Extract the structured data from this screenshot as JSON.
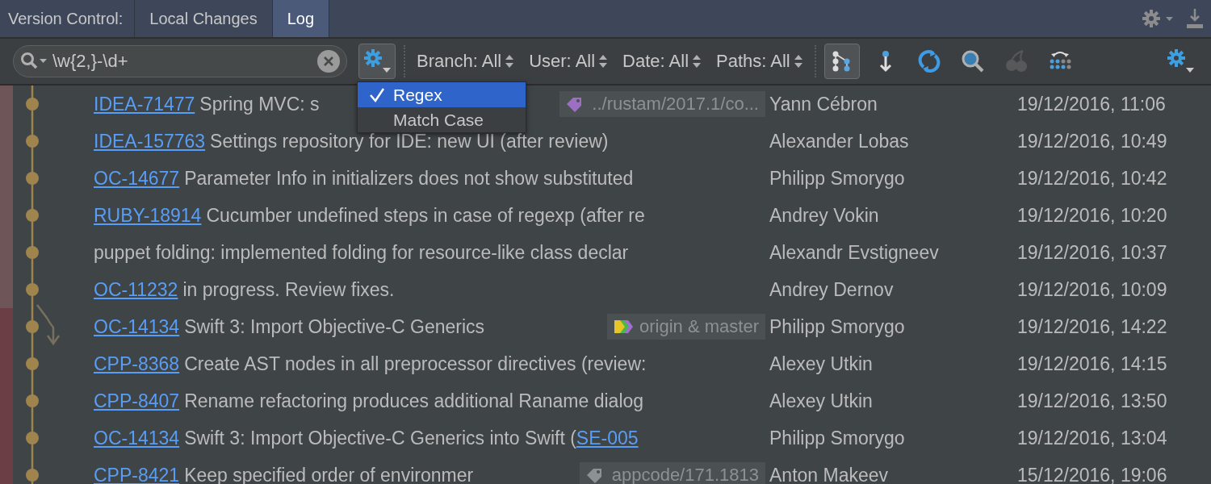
{
  "header": {
    "title": "Version Control:",
    "tabs": [
      {
        "label": "Local Changes",
        "selected": false
      },
      {
        "label": "Log",
        "selected": true
      }
    ]
  },
  "toolbar": {
    "search": {
      "value": "\\w{2,}-\\d+"
    },
    "filters": [
      {
        "label": "Branch: All"
      },
      {
        "label": "User: All"
      },
      {
        "label": "Date: All"
      },
      {
        "label": "Paths: All"
      }
    ],
    "tools": [
      {
        "kind": "graph",
        "selected": true,
        "disabled": false
      },
      {
        "kind": "fetch",
        "selected": false,
        "disabled": false
      },
      {
        "kind": "refresh",
        "selected": false,
        "disabled": false
      },
      {
        "kind": "search",
        "selected": false,
        "disabled": false
      },
      {
        "kind": "cherry",
        "selected": false,
        "disabled": true
      },
      {
        "kind": "layout",
        "selected": false,
        "disabled": false
      }
    ]
  },
  "search_menu": [
    {
      "label": "Regex",
      "checked": true,
      "selected": true
    },
    {
      "label": "Match Case",
      "checked": false,
      "selected": false
    }
  ],
  "commits": [
    {
      "ref": "IDEA-71477",
      "subject": "Spring MVC: s",
      "tag": {
        "text": "../rustam/2017.1/co...",
        "kind": "branch"
      },
      "author": "Yann Cébron",
      "date": "19/12/2016, 11:06"
    },
    {
      "ref": "IDEA-157763",
      "subject": "Settings repository for IDE: new UI (after review)",
      "author": "Alexander Lobas",
      "date": "19/12/2016, 10:49"
    },
    {
      "ref": "OC-14677",
      "subject": "Parameter Info in initializers does not show substituted",
      "author": "Philipp Smorygo",
      "date": "19/12/2016, 10:42"
    },
    {
      "ref": "RUBY-18914",
      "subject": "Cucumber undefined steps in case of regexp (after re",
      "author": "Andrey Vokin",
      "date": "19/12/2016, 10:20"
    },
    {
      "subject": "puppet folding: implemented folding for resource-like class declar",
      "author": "Alexandr Evstigneev",
      "date": "19/12/2016, 10:37"
    },
    {
      "ref": "OC-11232",
      "subject": "in progress. Review fixes.",
      "author": "Andrey Dernov",
      "date": "19/12/2016, 10:09"
    },
    {
      "ref": "OC-14134",
      "subject": "Swift 3: Import Objective-C Generics",
      "tag": {
        "text": "origin & master",
        "kind": "multi"
      },
      "author": "Philipp Smorygo",
      "date": "19/12/2016, 14:22"
    },
    {
      "ref": "CPP-8368",
      "subject": "Create AST nodes in all preprocessor directives (review:",
      "author": "Alexey Utkin",
      "date": "19/12/2016, 14:15"
    },
    {
      "ref": "CPP-8407",
      "subject": "Rename refactoring produces additional Raname dialog",
      "author": "Alexey Utkin",
      "date": "19/12/2016, 13:50"
    },
    {
      "ref": "OC-14134",
      "subject": "Swift 3: Import Objective-C Generics into Swift (",
      "subject_link": "SE-005",
      "author": "Philipp Smorygo",
      "date": "19/12/2016, 13:04"
    },
    {
      "ref": "CPP-8421",
      "subject": "Keep specified order of environmer",
      "tag": {
        "text": "appcode/171.1813",
        "kind": "plain"
      },
      "author": "Anton Makeev",
      "date": "15/12/2016, 19:06"
    }
  ]
}
